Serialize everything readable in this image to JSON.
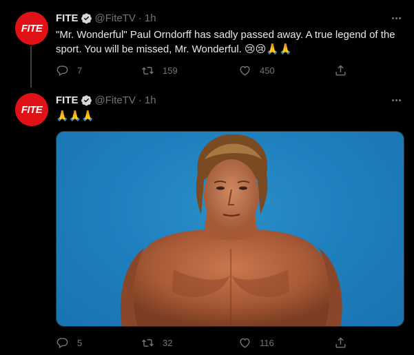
{
  "tweets": [
    {
      "avatar_text": "FITE",
      "name": "FITE",
      "handle": "@FiteTV",
      "separator": "·",
      "time": "1h",
      "text": "\"Mr. Wonderful\" Paul Orndorff has sadly passed away. A true legend of the sport. You will be missed, Mr. Wonderful.",
      "emoji": "😢😢🙏🙏",
      "replies": "7",
      "retweets": "159",
      "likes": "450"
    },
    {
      "avatar_text": "FITE",
      "name": "FITE",
      "handle": "@FiteTV",
      "separator": "·",
      "time": "1h",
      "text": "🙏🙏🙏",
      "replies": "5",
      "retweets": "32",
      "likes": "116"
    }
  ],
  "colors": {
    "background": "#000000",
    "avatar": "#e01218",
    "verified": "#d9d9d9",
    "muted_text": "#71767b",
    "media_background": "#1f80bf"
  }
}
